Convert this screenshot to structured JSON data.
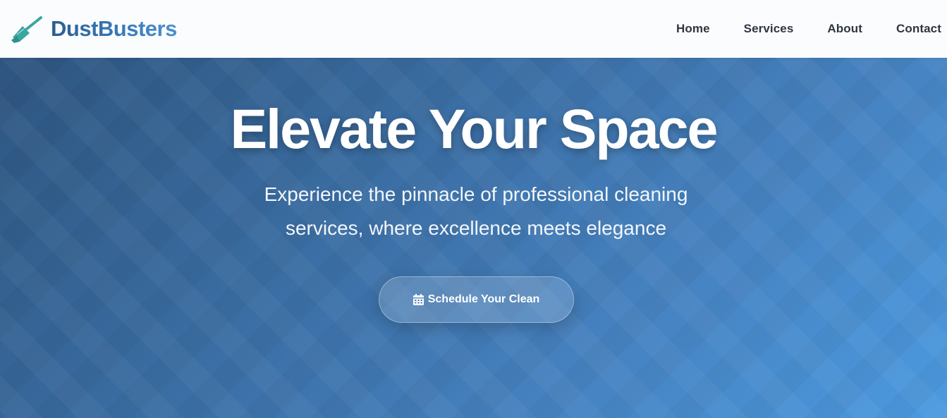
{
  "brand": {
    "name": "DustBusters",
    "icon": "broom-icon",
    "icon_color": "#3aa6a0"
  },
  "nav": {
    "items": [
      {
        "label": "Home"
      },
      {
        "label": "Services"
      },
      {
        "label": "About"
      },
      {
        "label": "Contact"
      }
    ]
  },
  "hero": {
    "title": "Elevate Your Space",
    "subtitle": "Experience the pinnacle of professional cleaning services, where excellence meets elegance",
    "cta": {
      "label": "Schedule Your Clean",
      "icon": "calendar-icon"
    }
  },
  "colors": {
    "brand_text_dark": "#2c5d8f",
    "brand_text_light": "#4a90d0",
    "hero_gradient_start": "#2e5580",
    "hero_gradient_end": "#4b9ae0",
    "nav_text": "#2f3540"
  }
}
